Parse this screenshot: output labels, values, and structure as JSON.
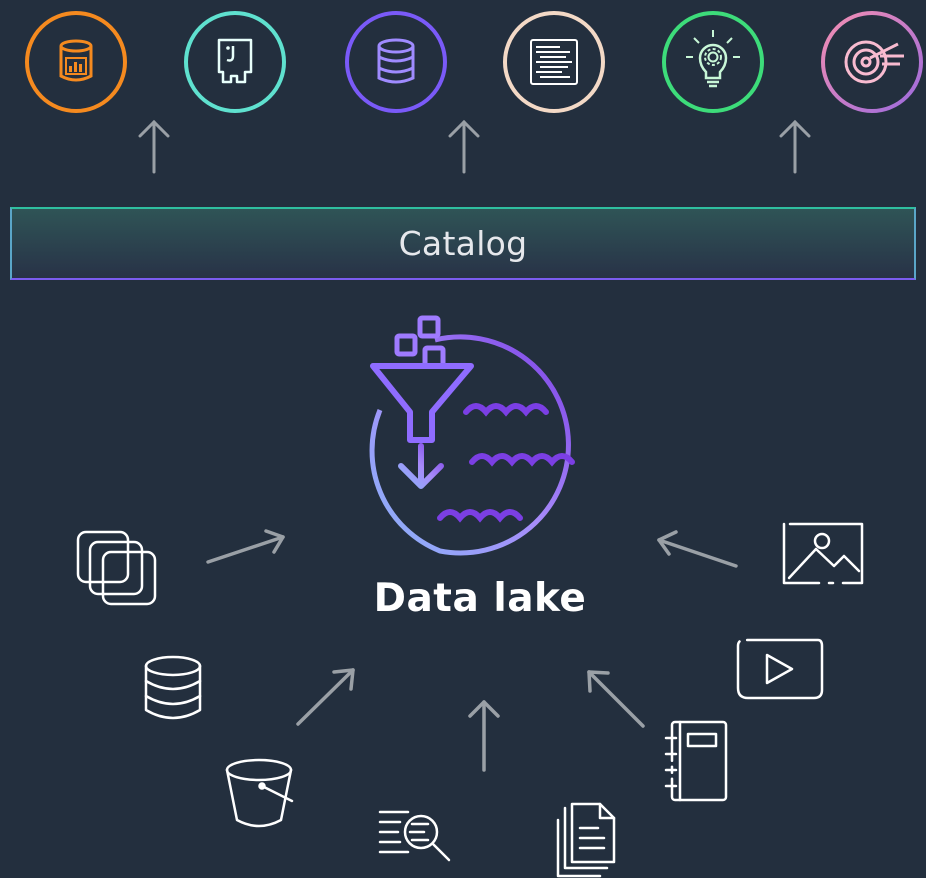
{
  "catalog": {
    "label": "Catalog"
  },
  "data_lake": {
    "label": "Data lake"
  },
  "consumers": [
    {
      "icon": "database-analytics-icon",
      "color": "#f58a1f"
    },
    {
      "icon": "emr-elephant-icon",
      "color": "#5fe1cf"
    },
    {
      "icon": "database-stack-icon",
      "color": "#7a5af8"
    },
    {
      "icon": "document-lines-icon",
      "color": "#f3d9c6"
    },
    {
      "icon": "lightbulb-gear-icon",
      "color": "#3ddc7a"
    },
    {
      "icon": "target-icon",
      "color": "#f06292"
    }
  ],
  "sources": [
    "stacked-squares-icon",
    "database-icon",
    "bucket-icon",
    "search-list-icon",
    "documents-icon",
    "notebook-icon",
    "video-icon",
    "image-icon"
  ],
  "colors": {
    "background": "#232f3e",
    "arrow": "#9aa0a6",
    "lake_gradient_start": "#8ab4f8",
    "lake_gradient_end": "#7b3fe4",
    "source_icon": "#ffffff"
  }
}
